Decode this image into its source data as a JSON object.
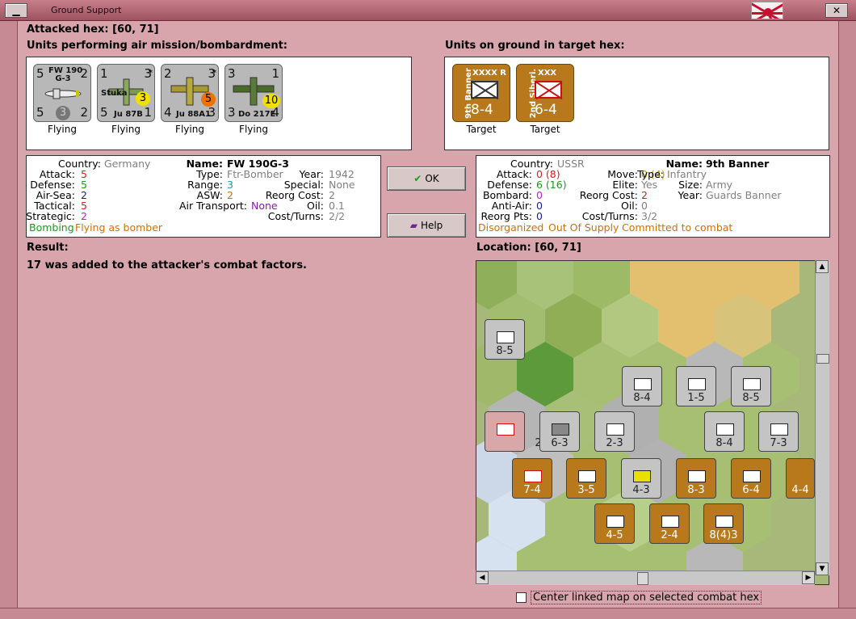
{
  "window": {
    "title": "Ground Support"
  },
  "attacked_hex": "Attacked hex:  [60, 71]",
  "attackers": {
    "heading": "Units performing air mission/bombardment:",
    "units": [
      {
        "top_left": "5",
        "top_right": "2",
        "bottom_left": "5",
        "bottom_right": "2",
        "center": "3",
        "name": "FW 190\nG-3",
        "status": "Flying"
      },
      {
        "top_left": "1",
        "top_right": "3",
        "bottom_left": "5",
        "bottom_right": "1",
        "center": "3",
        "name": "Ju 87B",
        "extra": "Stuka",
        "star": "*",
        "status": "Flying"
      },
      {
        "top_left": "2",
        "top_right": "3",
        "bottom_left": "4",
        "bottom_right": "3",
        "center": "5",
        "name": "Ju 88A1",
        "star": "*",
        "status": "Flying"
      },
      {
        "top_left": "3",
        "top_right": "1",
        "bottom_left": "3",
        "bottom_right": "4",
        "center": "10",
        "name": "Do 217E",
        "status": "Flying"
      }
    ]
  },
  "defenders": {
    "heading": "Units on ground in target hex:",
    "units": [
      {
        "size": "XXXX",
        "corner": "R",
        "side": "9th Banner",
        "value": "8-4",
        "status": "Target"
      },
      {
        "size": "XXX",
        "side": "2nd Siberi.",
        "value": "6-4",
        "status": "Target"
      }
    ]
  },
  "attacker_info": {
    "country_label": "Country:",
    "country": "Germany",
    "attack_label": "Attack:",
    "attack": "5",
    "defense_label": "Defense:",
    "defense": "5",
    "airsea_label": "Air-Sea:",
    "airsea": "2",
    "tactical_label": "Tactical:",
    "tactical": "5",
    "strategic_label": "Strategic:",
    "strategic": "2",
    "name_label": "Name:",
    "name": "FW 190G-3",
    "type_label": "Type:",
    "type": "Ftr-Bomber",
    "range_label": "Range:",
    "range": "3",
    "asw_label": "ASW:",
    "asw": "2",
    "airtransport_label": "Air Transport:",
    "airtransport": "None",
    "year_label": "Year:",
    "year": "1942",
    "special_label": "Special:",
    "special": "None",
    "reorg_label": "Reorg Cost:",
    "reorg": "2",
    "oil_label": "Oil:",
    "oil": "0.1",
    "costturns_label": "Cost/Turns:",
    "costturns": "2/2",
    "status_a": "Bombing",
    "status_b": "Flying as bomber"
  },
  "defender_info": {
    "country_label": "Country:",
    "country": "USSR",
    "attack_label": "Attack:",
    "attack": "0 (8)",
    "defense_label": "Defense:",
    "defense": "6 (16)",
    "bombard_label": "Bombard:",
    "bombard": "0",
    "antiair_label": "Anti-Air:",
    "antiair": "0",
    "reorgpts_label": "Reorg Pts:",
    "reorgpts": "0",
    "move_label": "Move:",
    "move": "0 (4)",
    "elite_label": "Elite:",
    "elite": "Yes",
    "reorg_label": "Reorg Cost:",
    "reorg": "2",
    "oil_label": "Oil:",
    "oil": "0",
    "costturns_label": "Cost/Turns:",
    "costturns": "3/2",
    "name_label": "Name:",
    "name": "9th Banner",
    "type_label": "Type:",
    "type": "Infantry",
    "size_label": "Size:",
    "size": "Army",
    "year_label": "Year:",
    "year": "Guards Banner",
    "status_a": "Disorganized",
    "status_b": "Out Of Supply",
    "status_c": "Committed to combat"
  },
  "buttons": {
    "ok": "OK",
    "help": "Help"
  },
  "result": {
    "label": "Result:",
    "text": "17 was added to the attacker's combat factors."
  },
  "location": {
    "label": "Location:  [60, 71]"
  },
  "map_counters": [
    {
      "label": "8-5"
    },
    {
      "label": "8-4"
    },
    {
      "label": "1-5"
    },
    {
      "label": "8-5"
    },
    {
      "label": "2-4"
    },
    {
      "label": "6-3"
    },
    {
      "label": "2-3"
    },
    {
      "label": "8-4"
    },
    {
      "label": "7-3"
    },
    {
      "label": "7-4"
    },
    {
      "label": "3-5"
    },
    {
      "label": "4-3"
    },
    {
      "label": "8-3"
    },
    {
      "label": "6-4"
    },
    {
      "label": "4-4"
    },
    {
      "label": "4-5"
    },
    {
      "label": "2-4"
    },
    {
      "label": "8(4)3"
    }
  ],
  "center_checkbox": {
    "label": "Center linked map on selected combat hex",
    "checked": false
  },
  "colors": {
    "background": "#d9a5ac",
    "axis_air": "#b8b8b8",
    "soviet_ground": "#b8791c",
    "red": "#d42020",
    "green": "#1a9a1a",
    "blue": "#1a1aa8",
    "magenta": "#c020c0",
    "orange": "#d07000",
    "grey": "#808080"
  }
}
